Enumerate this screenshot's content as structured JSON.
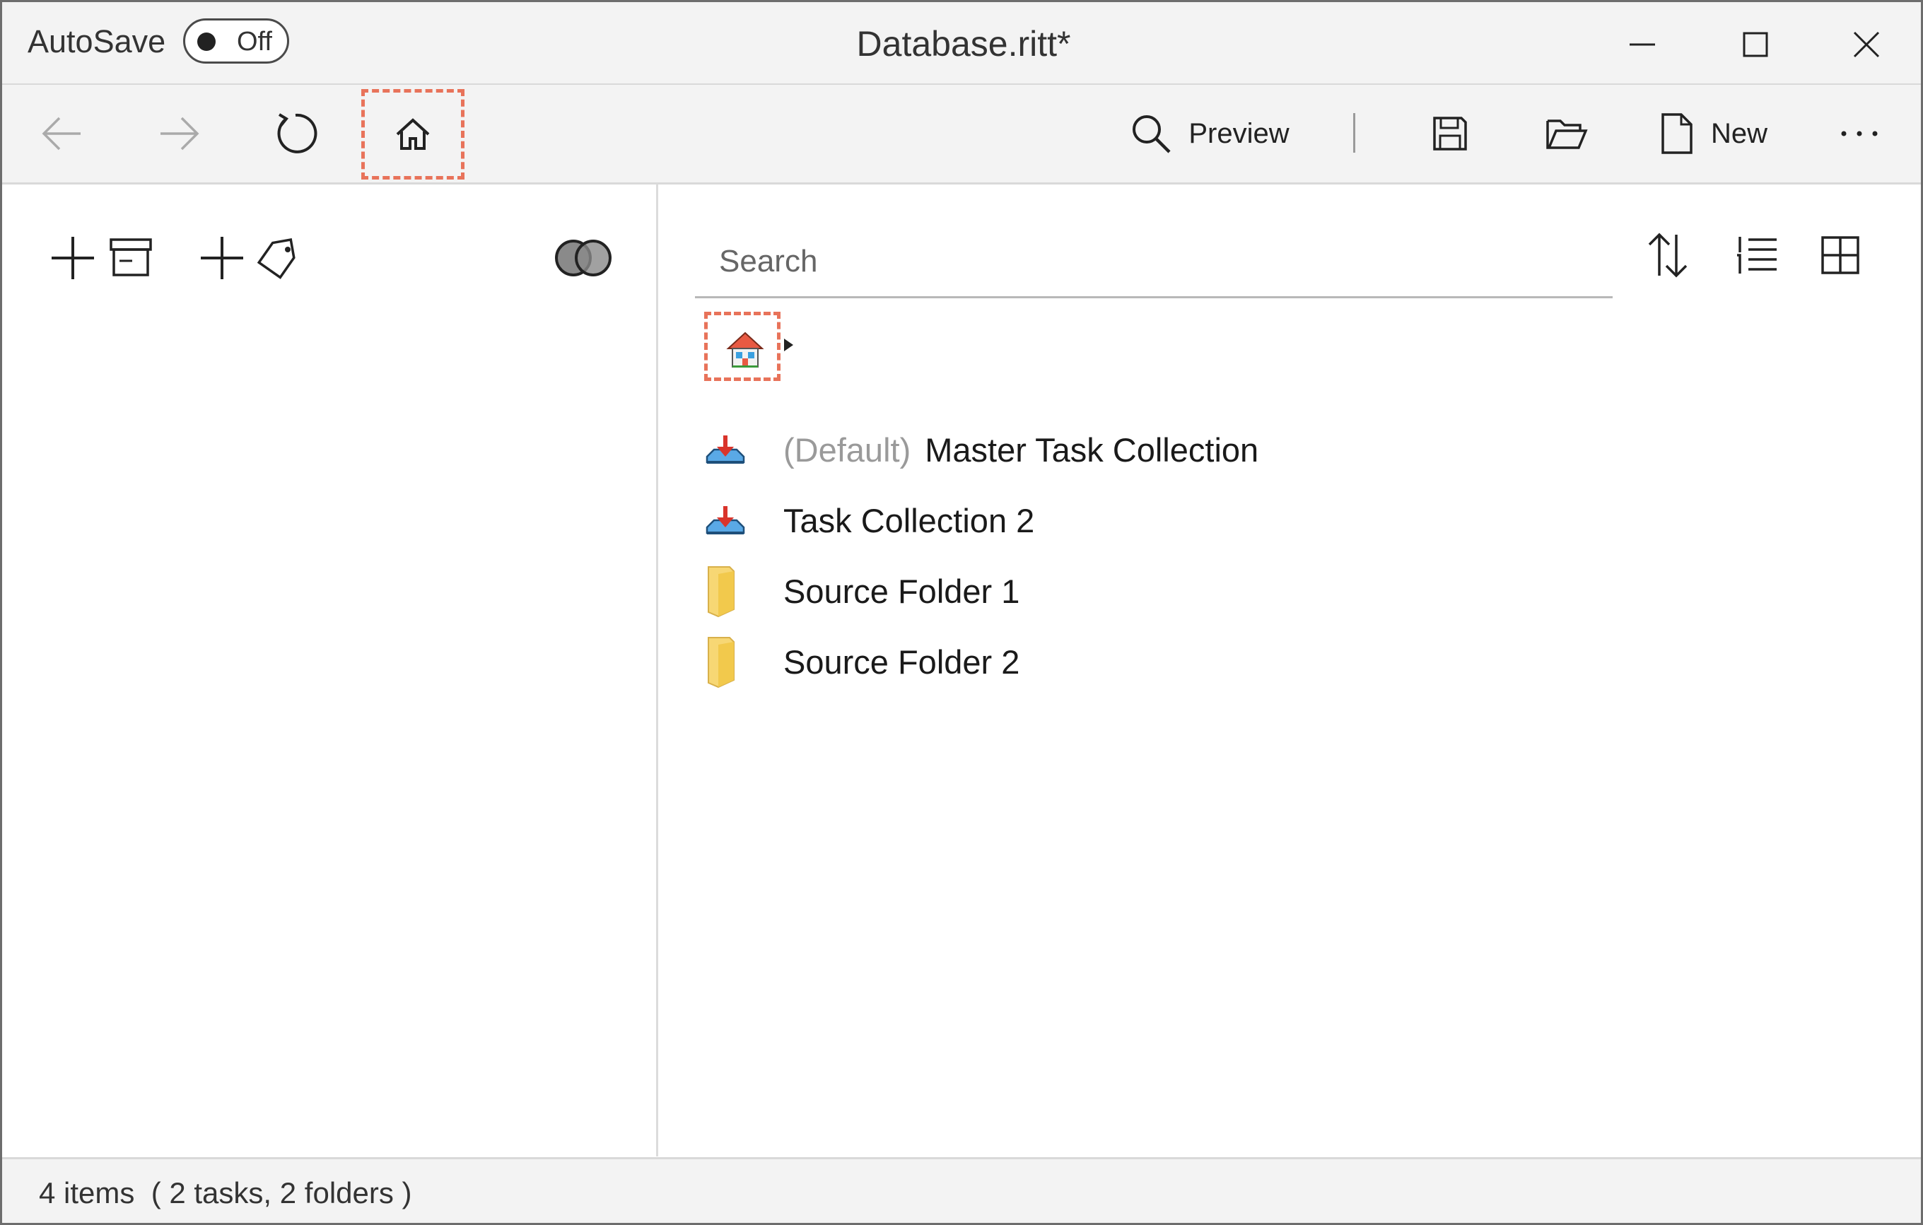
{
  "titlebar": {
    "autosave_label": "AutoSave",
    "autosave_state": "Off",
    "title": "Database.ritt*",
    "minimize_icon": "minimize-icon",
    "maximize_icon": "maximize-icon",
    "close_icon": "close-icon"
  },
  "toolbar": {
    "back_icon": "back-arrow-icon",
    "forward_icon": "forward-arrow-icon",
    "refresh_icon": "refresh-icon",
    "home_icon": "home-icon",
    "preview_label": "Preview",
    "save_icon": "save-icon",
    "open_icon": "open-folder-icon",
    "new_label": "New",
    "more_icon": "more-icon"
  },
  "left_pane": {
    "add_collection_icon": "add-collection-icon",
    "add_tag_icon": "add-tag-icon",
    "merge_icon": "merge-circles-icon"
  },
  "right_pane": {
    "search_placeholder": "Search",
    "search_value": "",
    "sort_icon": "sort-icon",
    "list_view_icon": "list-view-icon",
    "grid_view_icon": "grid-view-icon",
    "breadcrumb_home_icon": "house-icon"
  },
  "items": [
    {
      "type": "task-collection",
      "prefix": "(Default)",
      "label": "Master Task Collection"
    },
    {
      "type": "task-collection",
      "prefix": "",
      "label": "Task Collection 2"
    },
    {
      "type": "folder",
      "prefix": "",
      "label": "Source Folder 1"
    },
    {
      "type": "folder",
      "prefix": "",
      "label": "Source Folder 2"
    }
  ],
  "status": {
    "text": "4 items  ( 2 tasks, 2 folders )"
  },
  "colors": {
    "highlight": "#e8735a",
    "folder": "#f7d774",
    "task_icon_blue": "#5aa9e6",
    "task_icon_red": "#d9342b"
  }
}
